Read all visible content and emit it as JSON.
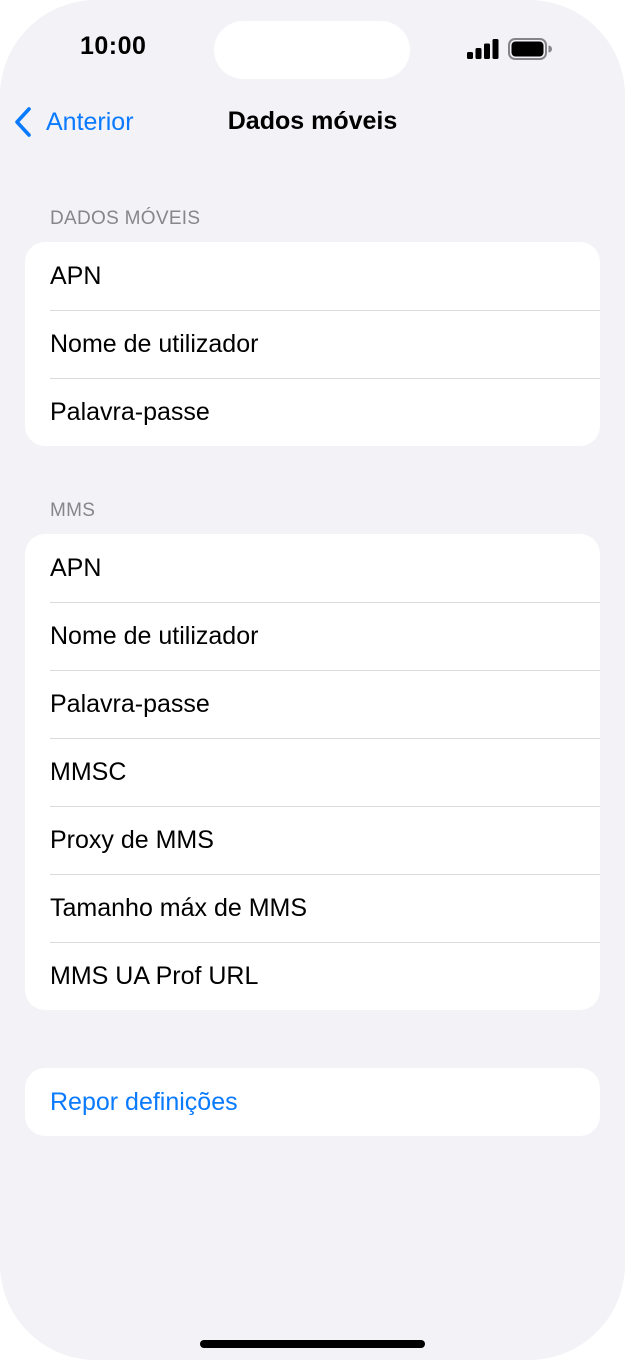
{
  "status_bar": {
    "time": "10:00",
    "signal_icon": "cellular-signal-icon",
    "battery_icon": "battery-full-icon"
  },
  "nav": {
    "back_label": "Anterior",
    "back_icon": "chevron-left-icon",
    "title": "Dados móveis"
  },
  "sections": {
    "mobile_data": {
      "header": "DADOS MÓVEIS",
      "items": [
        {
          "label": "APN"
        },
        {
          "label": "Nome de utilizador"
        },
        {
          "label": "Palavra-passe"
        }
      ]
    },
    "mms": {
      "header": "MMS",
      "items": [
        {
          "label": "APN"
        },
        {
          "label": "Nome de utilizador"
        },
        {
          "label": "Palavra-passe"
        },
        {
          "label": "MMSC"
        },
        {
          "label": "Proxy de MMS"
        },
        {
          "label": "Tamanho máx de MMS"
        },
        {
          "label": "MMS UA Prof URL"
        }
      ]
    },
    "reset": {
      "label": "Repor definições"
    }
  },
  "colors": {
    "accent": "#0a7aff",
    "background": "#f2f2f7",
    "card": "#ffffff",
    "secondary_text": "#86868b",
    "separator": "#d9d9de"
  }
}
